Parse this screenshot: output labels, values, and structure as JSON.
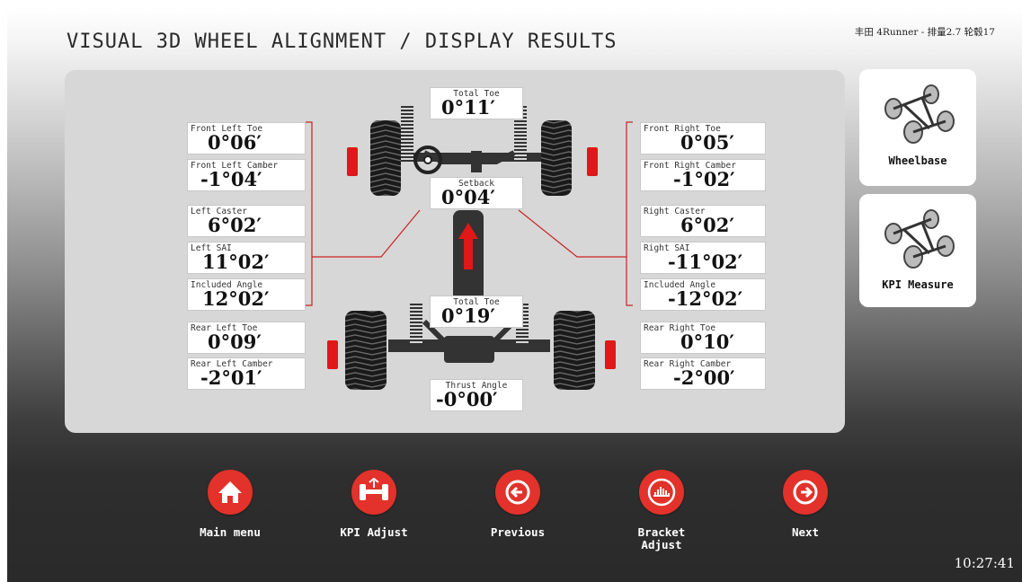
{
  "header": {
    "title": "VISUAL 3D WHEEL ALIGNMENT / DISPLAY RESULTS",
    "vehicle_info": "丰田 4Runner - 排量2.7 轮毂17"
  },
  "front": {
    "total_toe": {
      "label": "Total Toe",
      "value": "0°11′"
    },
    "setback": {
      "label": "Setback",
      "value": "0°04′"
    }
  },
  "rear": {
    "total_toe": {
      "label": "Total Toe",
      "value": "0°19′"
    },
    "thrust_angle": {
      "label": "Thrust Angle",
      "value": "-0°00′"
    }
  },
  "left": [
    {
      "label": "Front Left Toe",
      "value": "0°06′"
    },
    {
      "label": "Front Left Camber",
      "value": "-1°04′"
    },
    {
      "label": "Left Caster",
      "value": "6°02′"
    },
    {
      "label": "Left SAI",
      "value": "11°02′"
    },
    {
      "label": "Included Angle",
      "value": "12°02′"
    },
    {
      "label": "Rear Left Toe",
      "value": "0°09′"
    },
    {
      "label": "Rear Left Camber",
      "value": "-2°01′"
    }
  ],
  "right": [
    {
      "label": "Front Right Toe",
      "value": "0°05′"
    },
    {
      "label": "Front Right Camber",
      "value": "-1°02′"
    },
    {
      "label": "Right Caster",
      "value": "6°02′"
    },
    {
      "label": "Right SAI",
      "value": "-11°02′"
    },
    {
      "label": "Included Angle",
      "value": "-12°02′"
    },
    {
      "label": "Rear Right Toe",
      "value": "0°10′"
    },
    {
      "label": "Rear Right Camber",
      "value": "-2°00′"
    }
  ],
  "side_buttons": {
    "wheelbase": "Wheelbase",
    "kpi_measure": "KPI Measure"
  },
  "nav": {
    "main_menu": "Main menu",
    "kpi_adjust": "KPI Adjust",
    "previous": "Previous",
    "bracket_adjust": "Bracket\nAdjust",
    "next": "Next"
  },
  "clock": "10:27:41",
  "colors": {
    "accent": "#e2322b",
    "panel": "#d7d7d7",
    "indicator": "#e01818"
  }
}
